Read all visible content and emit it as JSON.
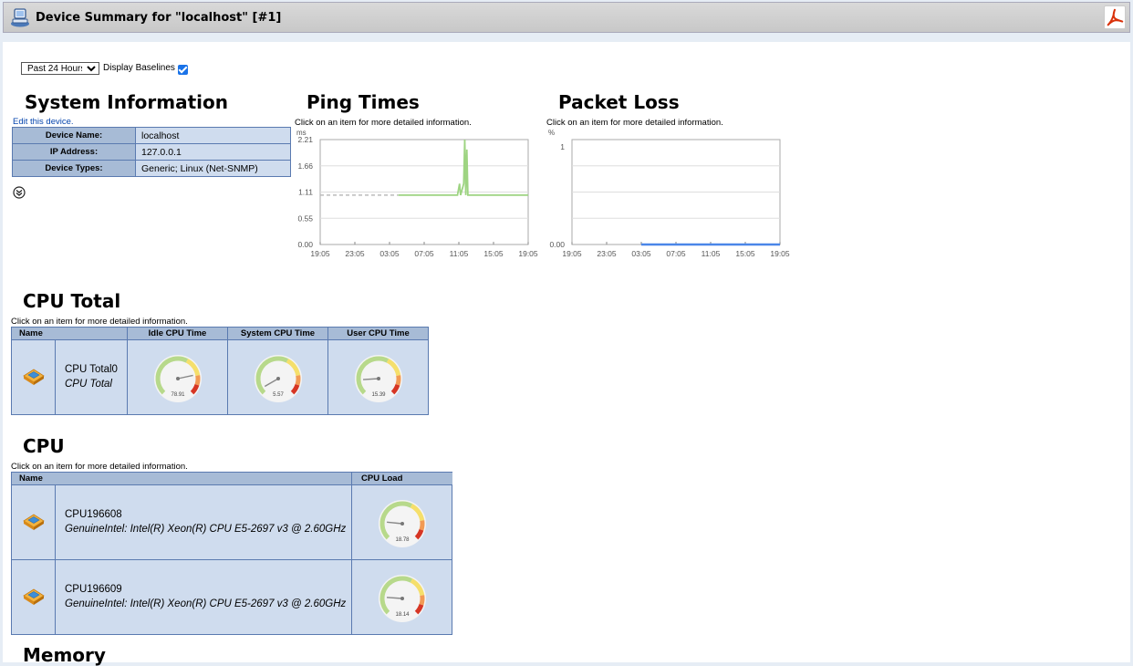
{
  "header": {
    "title": "Device Summary for \"localhost\" [#1]",
    "app_icon": "monitor-computer-icon",
    "export_icon": "pdf-export-icon"
  },
  "controls": {
    "period_selected": "Past 24 Hours",
    "baselines_label": "Display Baselines",
    "baselines_checked": true
  },
  "system_info": {
    "title": "System Information",
    "edit_link": "Edit this device.",
    "rows": [
      {
        "label": "Device Name:",
        "value": "localhost"
      },
      {
        "label": "IP Address:",
        "value": "127.0.0.1"
      },
      {
        "label": "Device Types:",
        "value": "Generic; Linux (Net-SNMP)"
      }
    ],
    "expand_icon": "expand-chevron-icon"
  },
  "ping": {
    "title": "Ping Times",
    "hint": "Click on an item for more detailed information.",
    "chart_data": {
      "type": "line",
      "ylabel": "ms",
      "yticks": [
        "2.21",
        "1.66",
        "1.11",
        "0.55",
        "0.00"
      ],
      "ylim": [
        0,
        2.21
      ],
      "xticks": [
        "19:05",
        "23:05",
        "03:05",
        "07:05",
        "11:05",
        "15:05",
        "19:05"
      ],
      "series": [
        {
          "values": [
            [
              0.0,
              0.0
            ],
            [
              0.376,
              1.04
            ],
            [
              0.66,
              1.04
            ],
            [
              0.67,
              1.28
            ],
            [
              0.675,
              1.04
            ],
            [
              0.69,
              1.28
            ],
            [
              0.695,
              2.21
            ],
            [
              0.7,
              1.04
            ],
            [
              0.705,
              2.0
            ],
            [
              0.71,
              1.04
            ],
            [
              1.0,
              1.04
            ]
          ]
        }
      ],
      "baseline": 1.04,
      "color": "#9ed482",
      "baseline_color": "#bbbbbb"
    }
  },
  "packet_loss": {
    "title": "Packet Loss",
    "hint": "Click on an item for more detailed information.",
    "chart_data": {
      "type": "line",
      "ylabel": "%",
      "yticks": [
        "1",
        "0.00"
      ],
      "ylim": [
        0,
        1
      ],
      "xticks": [
        "19:05",
        "23:05",
        "03:05",
        "07:05",
        "11:05",
        "15:05",
        "19:05"
      ],
      "series": [
        {
          "values": [
            [
              0.333,
              0.0
            ],
            [
              1.0,
              0.0
            ]
          ]
        }
      ],
      "color": "#4a86e8"
    }
  },
  "cpu_total": {
    "title": "CPU Total",
    "hint": "Click on an item for more detailed information.",
    "headers": [
      "Name",
      "Idle CPU Time",
      "System CPU Time",
      "User CPU Time"
    ],
    "rows": [
      {
        "name": "CPU Total0",
        "sub": "CPU Total",
        "icon": "cpu-chip-icon",
        "gauges": [
          78.91,
          5.57,
          15.39
        ],
        "gauge_labels": [
          "78.91",
          "5.57",
          "15.39"
        ]
      }
    ]
  },
  "cpu": {
    "title": "CPU",
    "hint": "Click on an item for more detailed information.",
    "headers": [
      "Name",
      "CPU Load"
    ],
    "rows": [
      {
        "name": "CPU196608",
        "sub": "GenuineIntel: Intel(R) Xeon(R) CPU E5-2697 v3 @ 2.60GHz",
        "icon": "cpu-chip-icon",
        "gauge": 18.78,
        "gauge_label": "18.78"
      },
      {
        "name": "CPU196609",
        "sub": "GenuineIntel: Intel(R) Xeon(R) CPU E5-2697 v3 @ 2.60GHz",
        "icon": "cpu-chip-icon",
        "gauge": 18.14,
        "gauge_label": "18.14"
      }
    ]
  },
  "memory": {
    "title": "Memory"
  },
  "colors": {
    "header_cell": "#a7bbd6",
    "data_cell": "#cfdcee",
    "border": "#5a7ab0",
    "link": "#0645ad"
  }
}
